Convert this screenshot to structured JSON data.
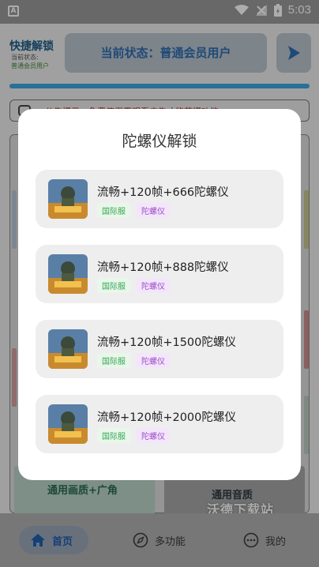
{
  "status_bar": {
    "time": "5:03"
  },
  "header": {
    "app_title": "快捷解锁",
    "sub_label": "当前状态:",
    "sub_value": "普通会员用户",
    "status_text": "当前状态：普通会员用户"
  },
  "notice": {
    "text": "公告提示：免费使用需观看广告才能获得功能"
  },
  "tiles": {
    "left_label": "通用画质+广角",
    "right_label": "通用音质"
  },
  "watermark": "沃德下载站",
  "bottom_nav": {
    "items": [
      {
        "label": "首页"
      },
      {
        "label": "多功能"
      },
      {
        "label": "我的"
      }
    ]
  },
  "modal": {
    "title": "陀螺仪解锁",
    "options": [
      {
        "title": "流畅+120帧+666陀螺仪",
        "tag1": "国际服",
        "tag2": "陀螺仪"
      },
      {
        "title": "流畅+120帧+888陀螺仪",
        "tag1": "国际服",
        "tag2": "陀螺仪"
      },
      {
        "title": "流畅+120帧+1500陀螺仪",
        "tag1": "国际服",
        "tag2": "陀螺仪"
      },
      {
        "title": "流畅+120帧+2000陀螺仪",
        "tag1": "国际服",
        "tag2": "陀螺仪"
      }
    ]
  },
  "colors": {
    "accent": "#3aa7e0",
    "tag_green": "#3aa655",
    "tag_purple": "#9b4bc8"
  }
}
